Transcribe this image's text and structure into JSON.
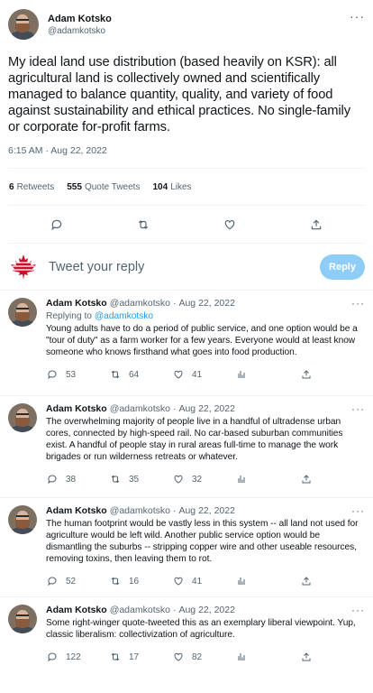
{
  "main_tweet": {
    "author_name": "Adam Kotsko",
    "author_handle": "@adamkotsko",
    "text": "My ideal land use distribution (based heavily on KSR): all agricultural land is collectively owned and scientifically managed to balance quantity, quality, and variety of food against sustainability and ethical practices. No single-family or corporate for-profit farms.",
    "timestamp": "6:15 AM · Aug 22, 2022",
    "stats": {
      "retweets_count": "6",
      "retweets_label": "Retweets",
      "quotes_count": "555",
      "quotes_label": "Quote Tweets",
      "likes_count": "104",
      "likes_label": "Likes"
    },
    "more_label": "···"
  },
  "reply_box": {
    "placeholder": "Tweet your reply",
    "button_label": "Reply",
    "button_color": "#8ecdf8"
  },
  "replies": [
    {
      "name": "Adam Kotsko",
      "handle": "@adamkotsko",
      "dot": "·",
      "date": "Aug 22, 2022",
      "more": "···",
      "replying_prefix": "Replying to",
      "replying_to": "@adamkotsko",
      "text": "Young adults have to do a period of public service, and one option would be a \"tour of duty\" as a farm worker for a few years. Everyone would at least know someone who knows firsthand what goes into food production.",
      "replies": "53",
      "retweets": "64",
      "likes": "41"
    },
    {
      "name": "Adam Kotsko",
      "handle": "@adamkotsko",
      "dot": "·",
      "date": "Aug 22, 2022",
      "more": "···",
      "text": "The overwhelming majority of people live in a handful of ultradense urban cores, connected by high-speed rail. No car-based suburban communities exist. A handful of people stay in rural areas full-time to manage the work brigades or run wilderness retreats or whatever.",
      "replies": "38",
      "retweets": "35",
      "likes": "32"
    },
    {
      "name": "Adam Kotsko",
      "handle": "@adamkotsko",
      "dot": "·",
      "date": "Aug 22, 2022",
      "more": "···",
      "text": "The human footprint would be vastly less in this system -- all land not used for agriculture would be left wild. Another public service option would be dismantling the suburbs -- stripping copper wire and other useable resources, removing toxins, then leaving them to rot.",
      "replies": "52",
      "retweets": "16",
      "likes": "41"
    },
    {
      "name": "Adam Kotsko",
      "handle": "@adamkotsko",
      "dot": "·",
      "date": "Aug 22, 2022",
      "more": "···",
      "text": "Some right-winger quote-tweeted this as an exemplary liberal viewpoint. Yup, classic liberalism: collectivization of agriculture.",
      "replies": "122",
      "retweets": "17",
      "likes": "82"
    }
  ],
  "colors": {
    "accent": "#1d9bf0",
    "muted_text": "#536471",
    "divider": "#eff3f4",
    "reply_avatar": "#c8102e"
  },
  "icons": [
    "reply-icon",
    "retweet-icon",
    "like-icon",
    "share-icon",
    "analytics-icon",
    "maple-leaf-icon",
    "more-icon"
  ]
}
